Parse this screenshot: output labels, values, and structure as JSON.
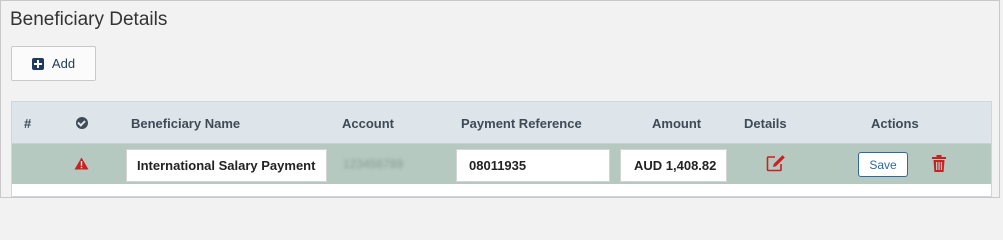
{
  "page": {
    "title": "Beneficiary Details"
  },
  "toolbar": {
    "add_label": "Add"
  },
  "table": {
    "headers": {
      "index": "#",
      "beneficiary_name": "Beneficiary Name",
      "account": "Account",
      "payment_reference": "Payment Reference",
      "amount": "Amount",
      "details": "Details",
      "actions": "Actions"
    },
    "rows": [
      {
        "status_icon": "warning-icon",
        "beneficiary_name": "International Salary Payment",
        "account": "123456789",
        "payment_reference": "08011935",
        "amount": "AUD 1,408.82",
        "save_label": "Save"
      }
    ]
  },
  "colors": {
    "header_bg": "#dde4ea",
    "row_bg": "#b5c9c0",
    "accent": "#1f3a5f",
    "danger": "#cc1f1f",
    "link": "#2c6aa0"
  },
  "icons": {
    "add": "plus-square-icon",
    "header_status": "check-circle-icon",
    "row_status": "warning-icon",
    "details": "edit-icon",
    "delete": "trash-icon"
  }
}
